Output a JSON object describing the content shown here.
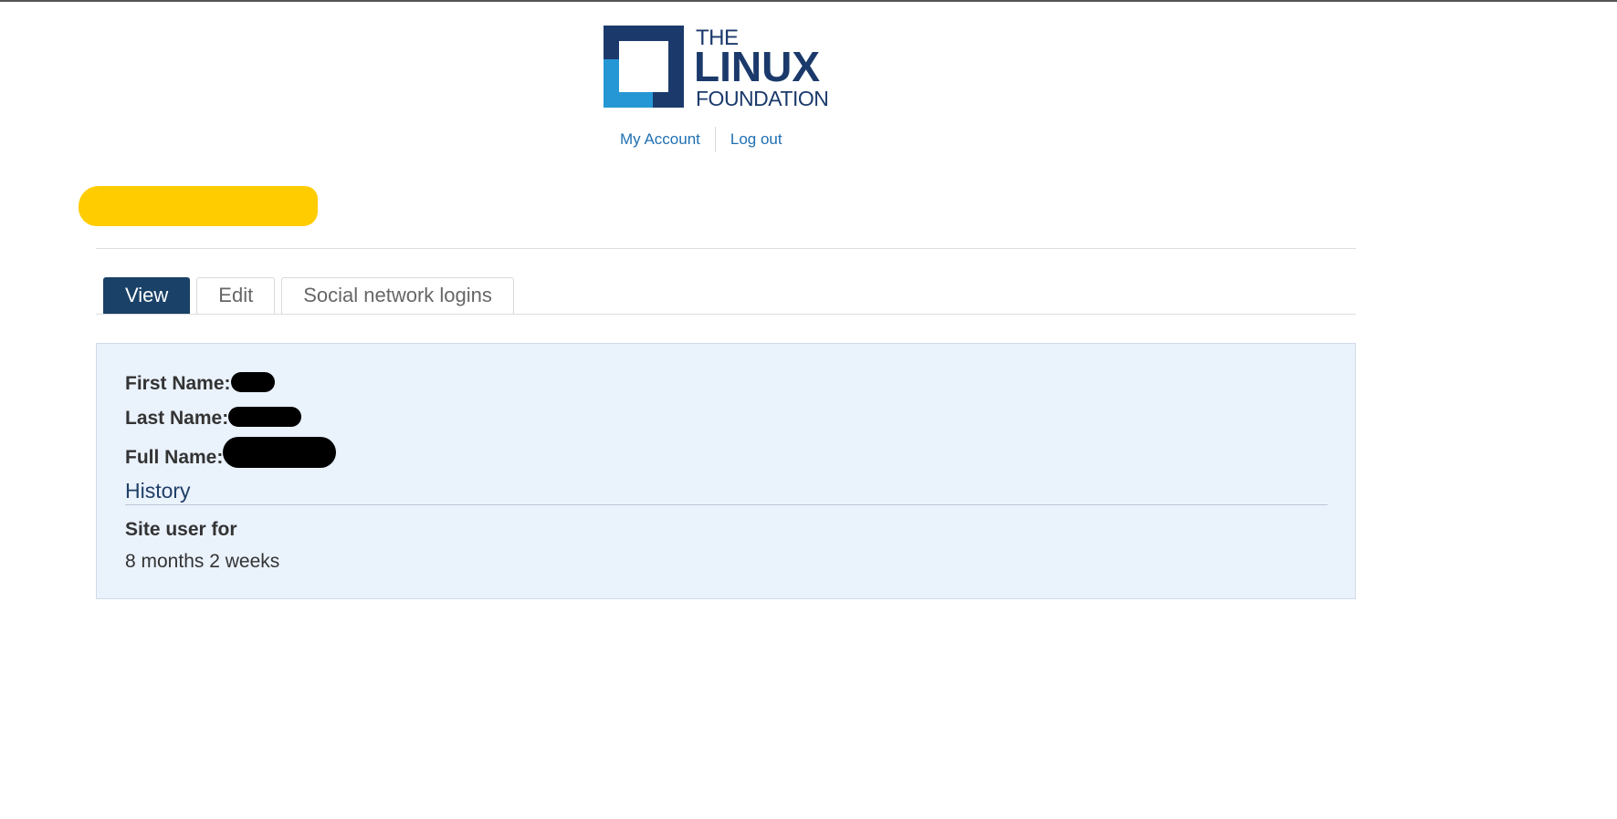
{
  "header": {
    "logo_alt": "The Linux Foundation",
    "logo_line1": "THE",
    "logo_line2": "LINUX",
    "logo_line3": "FOUNDATION",
    "colors": {
      "navy": "#1b3a6b",
      "light_blue": "#2597d4"
    }
  },
  "user_links": {
    "my_account": "My Account",
    "log_out": "Log out"
  },
  "tabs": [
    {
      "label": "View",
      "active": true
    },
    {
      "label": "Edit",
      "active": false
    },
    {
      "label": "Social network logins",
      "active": false
    }
  ],
  "profile": {
    "first_name_label": "First Name:",
    "last_name_label": "Last Name:",
    "full_name_label": "Full Name:",
    "history_heading": "History",
    "member_for_label": "Site user for",
    "member_for_value": "8 months 2 weeks"
  },
  "colors": {
    "tab_active_bg": "#1a4167",
    "link": "#1f6fb2",
    "panel_bg": "#eaf2fc",
    "title_redaction": "#ffcc00"
  }
}
